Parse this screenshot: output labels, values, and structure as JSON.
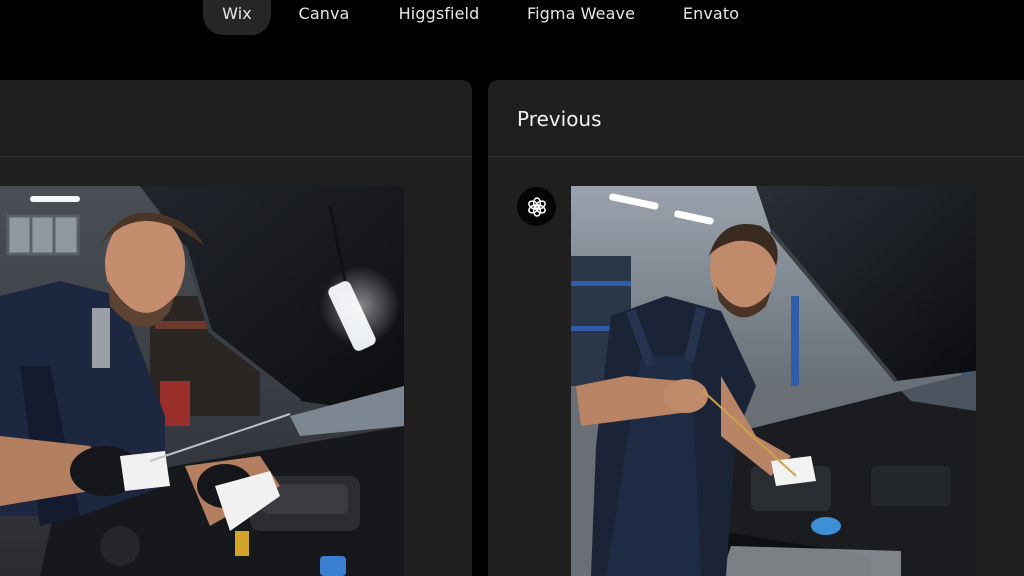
{
  "tabs": [
    {
      "label": "Wix",
      "active": true
    },
    {
      "label": "Canva",
      "active": false
    },
    {
      "label": "Higgsfield",
      "active": false
    },
    {
      "label": "Figma Weave",
      "active": false
    },
    {
      "label": "Envato",
      "active": false
    }
  ],
  "panels": {
    "left": {
      "title": ""
    },
    "right": {
      "title": "Previous",
      "model_icon": "openai-logo-icon"
    }
  },
  "colors": {
    "background": "#000000",
    "panel": "#1f1f1f",
    "active_tab": "#262626",
    "text": "#f2f2f2"
  }
}
